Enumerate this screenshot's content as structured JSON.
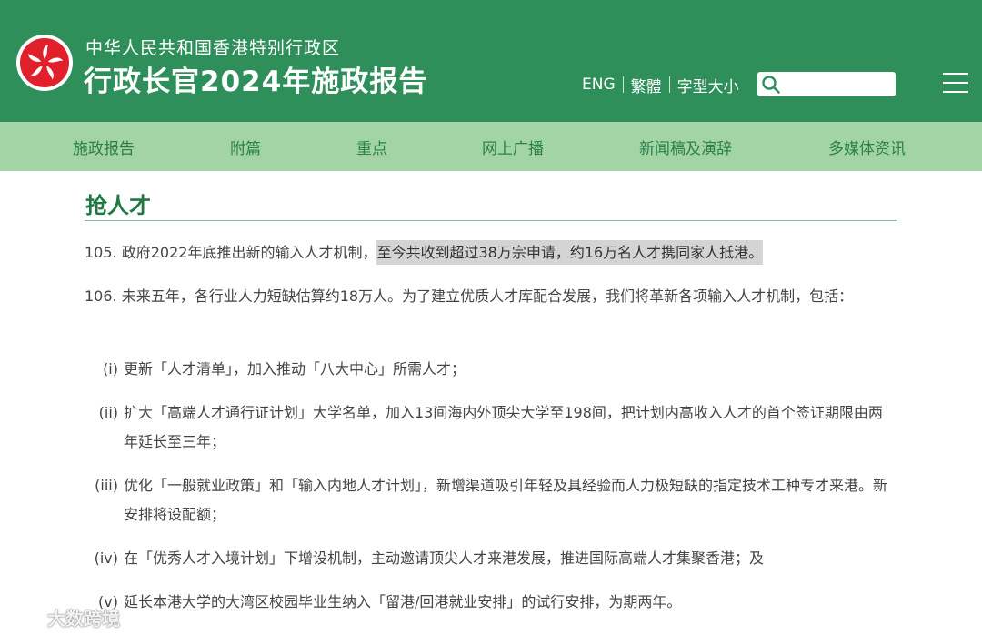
{
  "header": {
    "subtitle": "中华人民共和国香港特别行政区",
    "title": "行政长官2024年施政报告",
    "links": [
      "ENG",
      "繁體",
      "字型大小"
    ],
    "search_placeholder": ""
  },
  "nav": {
    "items": [
      "施政报告",
      "附篇",
      "重点",
      "网上广播",
      "新闻稿及演辞",
      "多媒体资讯"
    ]
  },
  "content": {
    "section_title": "抢人才",
    "p105_num": "105.",
    "p105_a": "政府2022年底推出新的输入人才机制，",
    "p105_b": "至今共收到超过38万宗申请，约16万名人才携同家人抵港。",
    "p106_num": "106.",
    "p106_text": "未来五年，各行业人力短缺估算约18万人。为了建立优质人才库配合发展，我们将革新各项输入人才机制，包括：",
    "items": [
      {
        "num": "(i)",
        "text": "更新「人才清单」，加入推动「八大中心」所需人才；"
      },
      {
        "num": "(ii)",
        "text": "扩大「高端人才通行证计划」大学名单，加入13间海内外顶尖大学至198间，把计划内高收入人才的首个签证期限由两年延长至三年；"
      },
      {
        "num": "(iii)",
        "text": "优化「一般就业政策」和「输入内地人才计划」，新增渠道吸引年轻及具经验而人力极短缺的指定技术工种专才来港。新安排将设配额；"
      },
      {
        "num": "(iv)",
        "text": "在「优秀人才入境计划」下增设机制，主动邀请顶尖人才来港发展，推进国际高端人才集聚香港；及"
      },
      {
        "num": "(v)",
        "text": "延长本港大学的大湾区校园毕业生纳入「留港/回港就业安排」的试行安排，为期两年。"
      }
    ]
  },
  "watermark": "大数跨境",
  "colors": {
    "header_bg": "#2f8f5b",
    "nav_bg": "#a3d4a6",
    "title_green": "#1f7a42",
    "highlight": "#d4d4d4"
  }
}
